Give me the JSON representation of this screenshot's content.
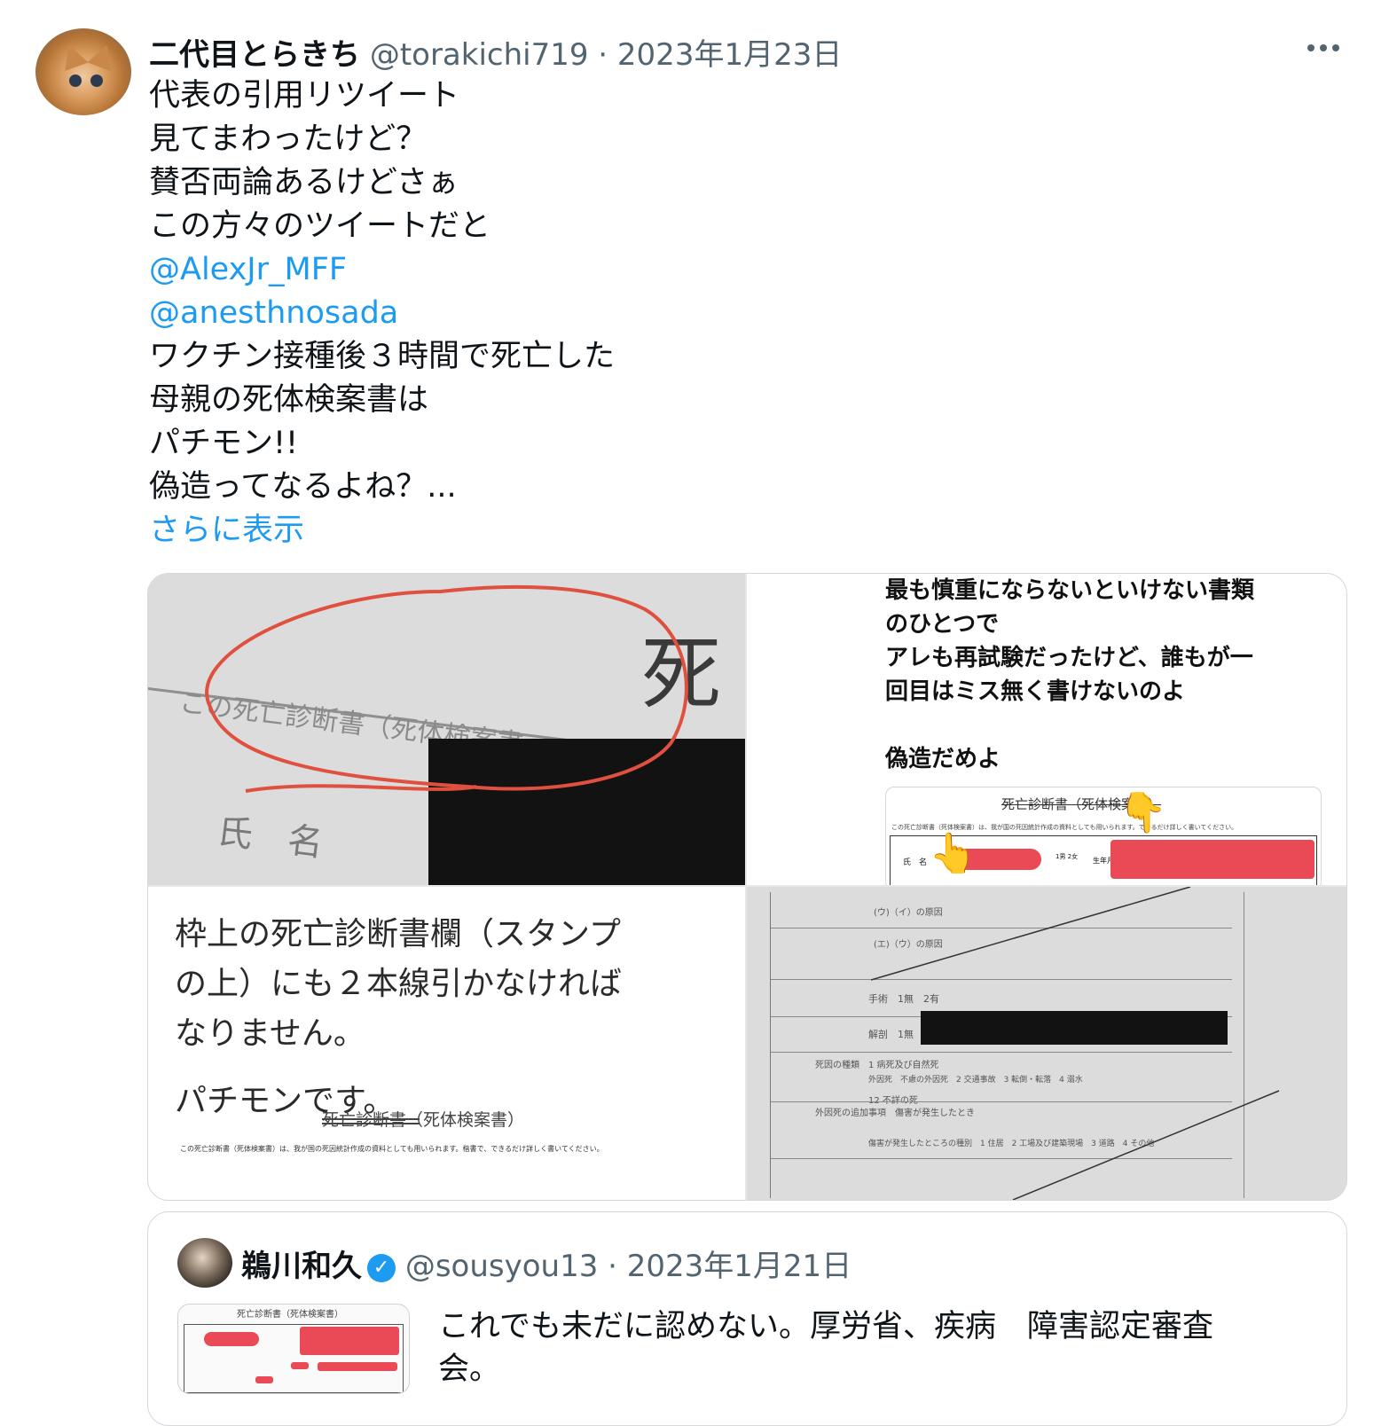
{
  "tweet": {
    "author_name": "二代目とらきち",
    "handle": "@torakichi719",
    "date": "2023年1月23日",
    "lines": [
      "代表の引用リツイート",
      "見てまわったけど？",
      "賛否両論あるけどさぁ",
      "この方々のツイートだと"
    ],
    "mentions": [
      "@AlexJr_MFF",
      "@anesthnosada"
    ],
    "lines_after": [
      "ワクチン接種後３時間で死亡した",
      "母親の死体検案書は",
      "パチモン!!",
      "偽造ってなるよね？..."
    ],
    "show_more": "さらに表示"
  },
  "media": {
    "top_left": {
      "big_char": "死",
      "stamp_line": "この死亡診断書（死体検案書",
      "name_label": "氏　名"
    },
    "top_right": {
      "lines": [
        "最も慎重にならないといけない書類",
        "のひとつで",
        "アレも再試験だったけど、誰もが一",
        "回目はミス無く書けないのよ"
      ],
      "footer": "偽造だめよ",
      "form_title": "死亡診断書（死体検案書）",
      "form_note": "この死亡診断書（死体検案書）は、我が国の死因統計作成の資料としても用いられます。できるだけ詳しく書いてください。",
      "name_label": "氏　名",
      "sex_label": "1男 2女",
      "dob_label": "生年月日"
    },
    "bottom_left": {
      "lines": [
        "枠上の死亡診断書欄（スタンプ",
        "の上）にも２本線引かなければ",
        "なりません。"
      ],
      "footer": "パチモンです。",
      "form_title": "死亡診断書（死体検案書）",
      "form_note": "この死亡診断書（死体検案書）は、我が国の死因統計作成の資料としても用いられます。楷書で、できるだけ詳しく書いてください。"
    },
    "bottom_right": {
      "rows": [
        "(ウ)（イ）の原因",
        "(エ)（ウ）の原因",
        "手術　1無　2有",
        "解剖　1無　2有",
        "死因の種類　1 病死及び自然死",
        "外因死　不慮の外因死　2 交通事故　3 転倒・転落　4 溺水",
        "12 不詳の死",
        "外因死の追加事項　傷害が発生したとき",
        "傷害が発生したところの種別　1 住居　2 工場及び建築現場　3 道路　4 その他"
      ]
    }
  },
  "quoted": {
    "author_name": "鵜川和久",
    "handle": "@sousyou13",
    "date": "2023年1月21日",
    "text_line1": "これでも未だに認めない。厚労省、疾病　障害認定審査",
    "text_line2": "会。",
    "thumb_title": "死亡診断書（死体検案書）"
  },
  "colors": {
    "link": "#1d9bf0",
    "muted": "#536471",
    "redaction_red": "#ea4a55",
    "circle_red": "#e0503f"
  }
}
